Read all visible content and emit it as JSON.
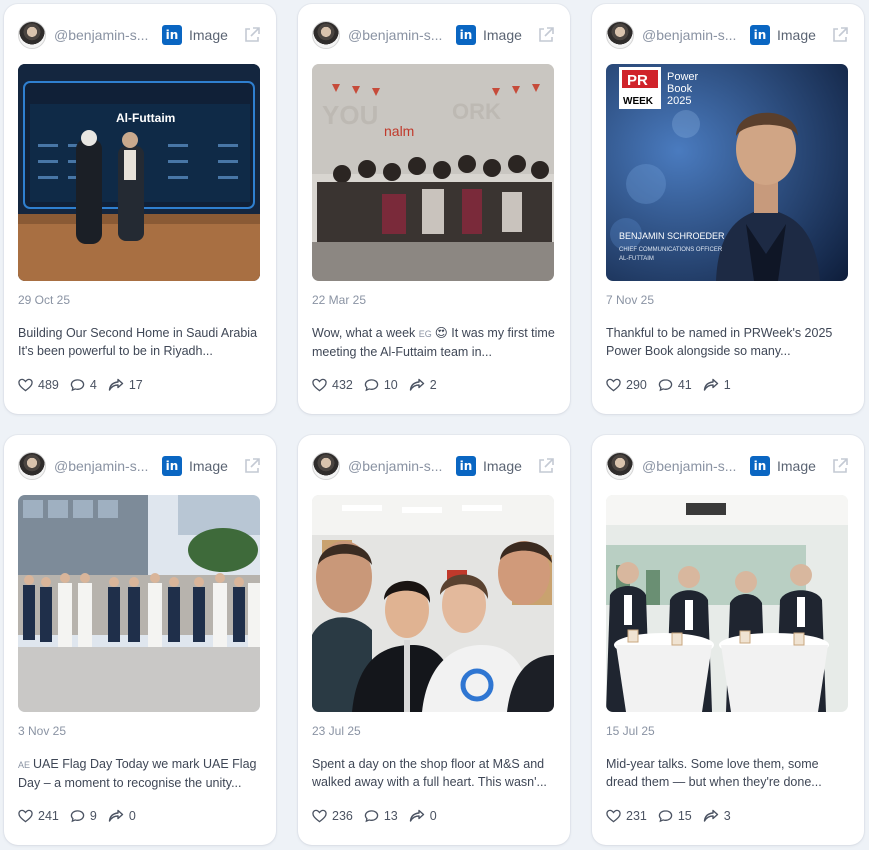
{
  "posts": [
    {
      "handle": "@benjamin-s...",
      "platform_icon": "in",
      "type": "Image",
      "date": "29 Oct 25",
      "text": "Building Our Second Home in Saudi Arabia It's been powerful to be in Riyadh...",
      "likes": "489",
      "comments": "4",
      "shares": "17",
      "image_text": {
        "logo": "Al-Futtaim"
      }
    },
    {
      "handle": "@benjamin-s...",
      "platform_icon": "in",
      "type": "Image",
      "date": "22 Mar 25",
      "text_prefix": "Wow, what a week",
      "text_flag": "EG",
      "text": "😍 It was my first time meeting the Al-Futtaim team in...",
      "likes": "432",
      "comments": "10",
      "shares": "2",
      "image_text": {
        "logo": "nalm"
      }
    },
    {
      "handle": "@benjamin-s...",
      "platform_icon": "in",
      "type": "Image",
      "date": "7 Nov 25",
      "text": "Thankful to be named in PRWeek's 2025 Power Book alongside so many...",
      "likes": "290",
      "comments": "41",
      "shares": "1",
      "image_text": {
        "badge_top": "PR",
        "badge_bottom": "WEEK",
        "heading_1": "Power",
        "heading_2": "Book",
        "heading_3": "2025",
        "name": "BENJAMIN SCHROEDER",
        "role_1": "CHIEF COMMUNICATIONS OFFICER",
        "role_2": "AL-FUTTAIM"
      }
    },
    {
      "handle": "@benjamin-s...",
      "platform_icon": "in",
      "type": "Image",
      "date": "3 Nov 25",
      "text_flag": "AE",
      "text": "UAE Flag Day Today we mark UAE Flag Day – a moment to recognise the unity...",
      "likes": "241",
      "comments": "9",
      "shares": "0"
    },
    {
      "handle": "@benjamin-s...",
      "platform_icon": "in",
      "type": "Image",
      "date": "23 Jul 25",
      "text": "Spent a day on the shop floor at M&S and walked away with a full heart. This wasn'...",
      "likes": "236",
      "comments": "13",
      "shares": "0"
    },
    {
      "handle": "@benjamin-s...",
      "platform_icon": "in",
      "type": "Image",
      "date": "15 Jul 25",
      "text": "Mid-year talks. Some love them, some dread them — but when they're done...",
      "likes": "231",
      "comments": "15",
      "shares": "3"
    }
  ],
  "colors": {
    "background": "#eef2f7",
    "card": "#ffffff",
    "linkedin": "#0a66c2",
    "muted": "#8a93a3"
  },
  "icons": {
    "like": "heart-icon",
    "comment": "comment-icon",
    "share": "share-icon",
    "external": "external-link-icon",
    "platform": "linkedin-icon"
  }
}
